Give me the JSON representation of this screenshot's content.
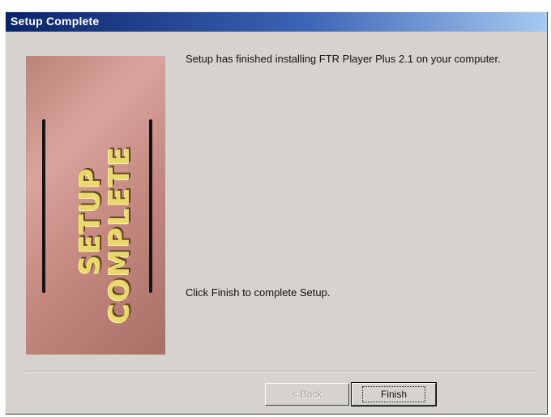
{
  "window": {
    "title": "Setup Complete"
  },
  "banner": {
    "line1": "SETUP",
    "line2": "COMPLETE"
  },
  "content": {
    "message": "Setup has finished installing FTR Player Plus 2.1 on your computer.",
    "instruction": "Click Finish to complete Setup."
  },
  "buttons": {
    "back_label": "< Back",
    "finish_label": "Finish"
  }
}
